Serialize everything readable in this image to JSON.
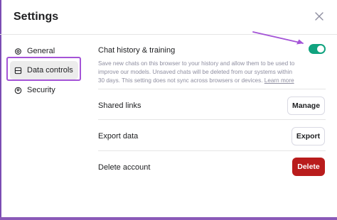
{
  "dialog": {
    "title": "Settings"
  },
  "nav": {
    "items": [
      {
        "label": "General",
        "icon": "gear-icon"
      },
      {
        "label": "Data controls",
        "icon": "database-icon",
        "selected": true
      },
      {
        "label": "Security",
        "icon": "shield-icon"
      }
    ]
  },
  "history": {
    "label": "Chat history & training",
    "description": "Save new chats on this browser to your history and allow them to be used to improve our models. Unsaved chats will be deleted from our systems within 30 days. This setting does not sync across browsers or devices.",
    "learn_more": "Learn more",
    "enabled": true
  },
  "shared_links": {
    "label": "Shared links",
    "button": "Manage"
  },
  "export_data": {
    "label": "Export data",
    "button": "Export"
  },
  "delete_account": {
    "label": "Delete account",
    "button": "Delete"
  },
  "colors": {
    "toggle_on": "#10a37f",
    "danger": "#b91c1c",
    "annotation": "#a454d7"
  }
}
